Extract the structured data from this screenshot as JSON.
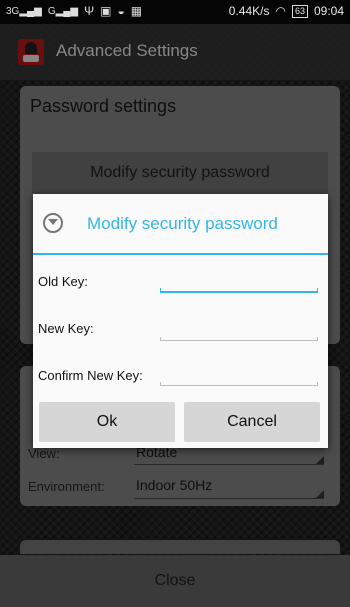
{
  "status_bar": {
    "signal_left": "3G",
    "signal_right": "G",
    "speed": "0.44K/s",
    "battery": "63",
    "time": "09:04"
  },
  "action_bar": {
    "title": "Advanced Settings"
  },
  "background": {
    "password_header": "Password settings",
    "modify_button": "Modify security password",
    "view_label": "View:",
    "view_value": "Rotate",
    "environment_label": "Environment:",
    "environment_value": "Indoor 50Hz",
    "close_button": "Close"
  },
  "dialog": {
    "title": "Modify security password",
    "fields": [
      {
        "label": "Old Key:",
        "value": ""
      },
      {
        "label": "New Key:",
        "value": ""
      },
      {
        "label": "Confirm New Key:",
        "value": ""
      }
    ],
    "ok_button": "Ok",
    "cancel_button": "Cancel"
  },
  "colors": {
    "accent": "#33b5e5"
  }
}
